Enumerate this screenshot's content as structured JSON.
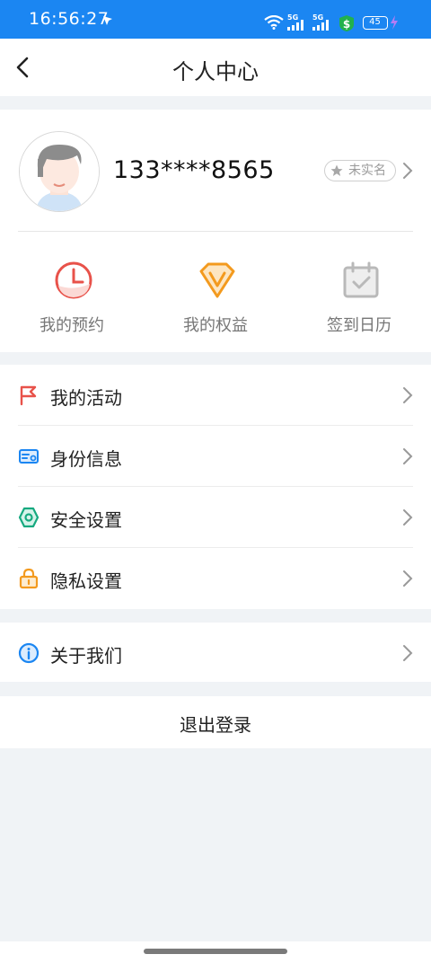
{
  "status_bar": {
    "time": "16:56:27",
    "network_1": "5G",
    "network_2": "5G",
    "battery": "45"
  },
  "header": {
    "title": "个人中心"
  },
  "profile": {
    "phone": "133****8565",
    "verify_badge": "未实名"
  },
  "quick_actions": [
    {
      "label": "我的预约",
      "icon": "clock-icon",
      "color": "#e8524a"
    },
    {
      "label": "我的权益",
      "icon": "diamond-icon",
      "color": "#f39a1e"
    },
    {
      "label": "签到日历",
      "icon": "calendar-check-icon",
      "color": "#b9b9b9"
    }
  ],
  "menu": [
    {
      "label": "我的活动",
      "icon": "flag-icon",
      "color": "#e8524a"
    },
    {
      "label": "身份信息",
      "icon": "id-card-icon",
      "color": "#1b86f2"
    },
    {
      "label": "安全设置",
      "icon": "shield-hex-icon",
      "color": "#16a97f"
    },
    {
      "label": "隐私设置",
      "icon": "lock-icon",
      "color": "#f39a1e"
    }
  ],
  "about": {
    "label": "关于我们",
    "icon": "info-icon",
    "color": "#1b86f2"
  },
  "logout_label": "退出登录"
}
